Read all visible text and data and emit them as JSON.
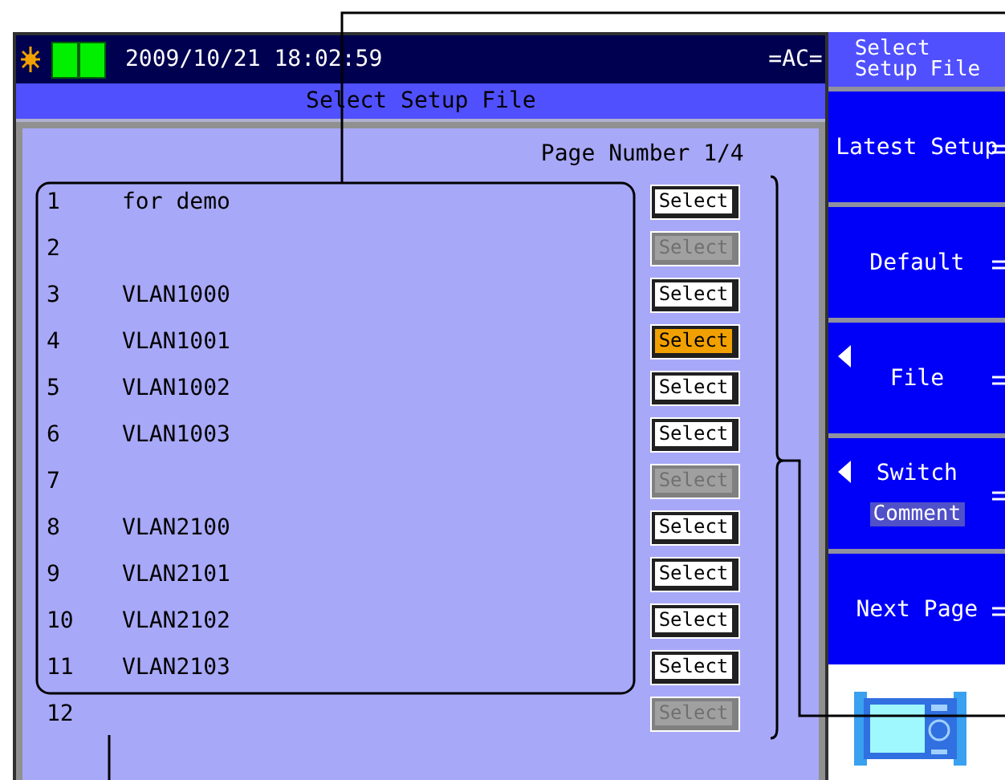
{
  "status_bar": {
    "datetime": "2009/10/21 18:02:59",
    "power": "=AC="
  },
  "title": "Select Setup File",
  "page_number": "Page Number 1/4",
  "rows": [
    {
      "number": "1",
      "name": "for demo",
      "button": {
        "label": "Select",
        "disabled": false,
        "selected": false
      }
    },
    {
      "number": "2",
      "button": {
        "label": "Select",
        "disabled": true,
        "selected": false
      }
    },
    {
      "number": "3",
      "name": "VLAN1000",
      "button": {
        "label": "Select",
        "disabled": false,
        "selected": false
      }
    },
    {
      "number": "4",
      "name": "VLAN1001",
      "button": {
        "label": "Select",
        "disabled": false,
        "selected": true
      }
    },
    {
      "number": "5",
      "name": "VLAN1002",
      "button": {
        "label": "Select",
        "disabled": false,
        "selected": false
      }
    },
    {
      "number": "6",
      "name": "VLAN1003",
      "button": {
        "label": "Select",
        "disabled": false,
        "selected": false
      }
    },
    {
      "number": "7",
      "button": {
        "label": "Select",
        "disabled": true,
        "selected": false
      }
    },
    {
      "number": "8",
      "name": "VLAN2100",
      "button": {
        "label": "Select",
        "disabled": false,
        "selected": false
      }
    },
    {
      "number": "9",
      "name": "VLAN2101",
      "button": {
        "label": "Select",
        "disabled": false,
        "selected": false
      }
    },
    {
      "number": "10",
      "name": "VLAN2102",
      "button": {
        "label": "Select",
        "disabled": false,
        "selected": false
      }
    },
    {
      "number": "11",
      "name": "VLAN2103",
      "button": {
        "label": "Select",
        "disabled": false,
        "selected": false
      }
    },
    {
      "number": "12",
      "button": {
        "label": "Select",
        "disabled": true,
        "selected": false
      }
    }
  ],
  "softkeys": {
    "header": "Select\nSetup File",
    "keys": [
      {
        "kind": "plain",
        "label": "Latest Setup"
      },
      {
        "kind": "plain",
        "label": "Default"
      },
      {
        "kind": "menu",
        "label": "File"
      },
      {
        "kind": "switch",
        "label": "Switch",
        "badge": "Comment"
      },
      {
        "kind": "plain",
        "label": "Next Page"
      }
    ]
  }
}
